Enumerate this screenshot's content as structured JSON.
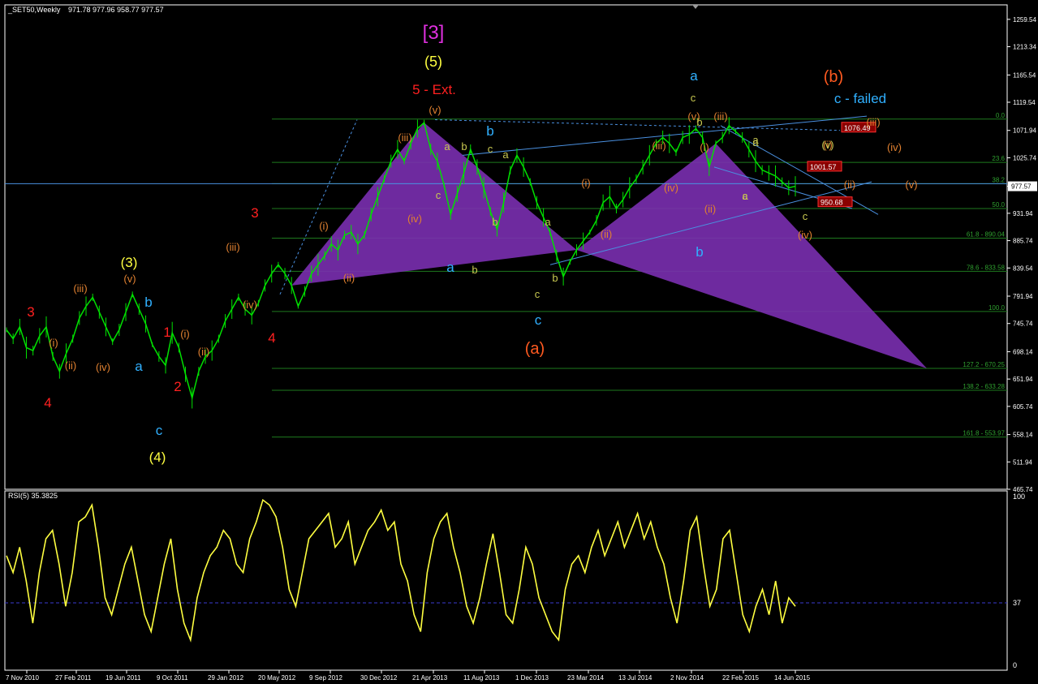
{
  "header": {
    "symbol": "_SET50,Weekly",
    "ohlc": "971.78 977.96 958.77 977.57"
  },
  "rsi_header": "RSI(5) 35.3825",
  "colors": {
    "background": "#000000",
    "frame": "#ffffff",
    "candles": "#00e000",
    "rsi": "#ffff40",
    "fib": "#1e7a1e",
    "pattern": "#7a2fb0",
    "trend": "#4a90e0"
  },
  "chart_data": [
    {
      "type": "line",
      "title": "",
      "xlabel": "",
      "ylabel": "",
      "x_ticks": [
        "7 Nov 2010",
        "27 Feb 2011",
        "19 Jun 2011",
        "9 Oct 2011",
        "29 Jan 2012",
        "20 May 2012",
        "9 Sep 2012",
        "30 Dec 2012",
        "21 Apr 2013",
        "11 Aug 2013",
        "1 Dec 2013",
        "23 Mar 2014",
        "13 Jul 2014",
        "2 Nov 2014",
        "22 Feb 2015",
        "14 Jun 2015"
      ],
      "y_ticks": [
        "1259.54",
        "1213.34",
        "1165.54",
        "1119.54",
        "1071.94",
        "1025.74",
        "977.57",
        "931.94",
        "885.74",
        "839.54",
        "791.94",
        "745.74",
        "698.14",
        "651.94",
        "605.74",
        "558.14",
        "511.94",
        "465.74"
      ],
      "ylim": [
        465.74,
        1284
      ],
      "last_price": "977.57",
      "series": [
        {
          "values": [
            735,
            720,
            740,
            705,
            700,
            725,
            740,
            690,
            665,
            695,
            720,
            755,
            775,
            790,
            765,
            740,
            715,
            735,
            765,
            795,
            770,
            745,
            710,
            690,
            675,
            730,
            705,
            660,
            620,
            665,
            690,
            700,
            720,
            750,
            770,
            790,
            770,
            760,
            780,
            810,
            830,
            845,
            830,
            810,
            775,
            800,
            830,
            845,
            860,
            880,
            870,
            895,
            900,
            880,
            895,
            930,
            960,
            990,
            1020,
            1040,
            1020,
            1050,
            1075,
            1085,
            1040,
            1020,
            980,
            930,
            965,
            1000,
            1040,
            1010,
            975,
            935,
            905,
            950,
            1005,
            1030,
            1010,
            985,
            950,
            925,
            900,
            860,
            825,
            850,
            870,
            885,
            900,
            920,
            950,
            960,
            940,
            955,
            975,
            990,
            1010,
            1030,
            1050,
            1060,
            1050,
            1035,
            1060,
            1065,
            1075,
            1060,
            1010,
            1050,
            1060,
            1080,
            1070,
            1060,
            1040,
            1020,
            1005,
            1000,
            995,
            985,
            975,
            977.57
          ]
        }
      ],
      "fib_levels": [
        {
          "label": "0.0",
          "price": 1091
        },
        {
          "label": "23.6",
          "price": 1018
        },
        {
          "label": "38.2",
          "price": 982
        },
        {
          "label": "50.0",
          "price": 940
        },
        {
          "label": "61.8 - 890.04",
          "price": 890
        },
        {
          "label": "78.6 - 833.58",
          "price": 834
        },
        {
          "label": "100.0",
          "price": 766
        },
        {
          "label": "127.2 - 670.25",
          "price": 670
        },
        {
          "label": "138.2 - 633.28",
          "price": 633
        },
        {
          "label": "161.8 - 553.97",
          "price": 554
        }
      ],
      "price_tags": [
        "1076.49",
        "1001.57",
        "950.68"
      ],
      "wave_labels": [
        {
          "t": "[3]",
          "c": "#e030e0",
          "s": 24
        },
        {
          "t": "(5)",
          "c": "#ffff40",
          "s": 18
        },
        {
          "t": "5 - Ext.",
          "c": "#ff2020",
          "s": 17
        },
        {
          "t": "a",
          "c": "#30b0ff",
          "s": 17
        },
        {
          "t": "(b)",
          "c": "#ff5a20",
          "s": 20
        },
        {
          "t": "c - failed",
          "c": "#30b0ff",
          "s": 17
        },
        {
          "t": "(3)",
          "c": "#ffff40",
          "s": 17
        },
        {
          "t": "(4)",
          "c": "#ffff40",
          "s": 17
        },
        {
          "t": "(a)",
          "c": "#ff5a20",
          "s": 20
        },
        {
          "t": "3",
          "c": "#ff2020",
          "s": 17
        },
        {
          "t": "4",
          "c": "#ff2020",
          "s": 17
        },
        {
          "t": "3",
          "c": "#ff2020",
          "s": 17
        },
        {
          "t": "4",
          "c": "#ff2020",
          "s": 17
        },
        {
          "t": "1",
          "c": "#ff2020",
          "s": 17
        },
        {
          "t": "2",
          "c": "#ff2020",
          "s": 17
        },
        {
          "t": "a",
          "c": "#30b0ff",
          "s": 17
        },
        {
          "t": "b",
          "c": "#30b0ff",
          "s": 17
        },
        {
          "t": "c",
          "c": "#30b0ff",
          "s": 17
        },
        {
          "t": "b",
          "c": "#30b0ff",
          "s": 17
        },
        {
          "t": "a",
          "c": "#30b0ff",
          "s": 17
        },
        {
          "t": "c",
          "c": "#30b0ff",
          "s": 17
        },
        {
          "t": "b",
          "c": "#30b0ff",
          "s": 17
        },
        {
          "t": "(i)",
          "c": "#e08030",
          "s": 13
        },
        {
          "t": "(ii)",
          "c": "#e08030",
          "s": 13
        },
        {
          "t": "(iii)",
          "c": "#e08030",
          "s": 13
        },
        {
          "t": "(iv)",
          "c": "#e08030",
          "s": 13
        },
        {
          "t": "(v)",
          "c": "#e08030",
          "s": 13
        },
        {
          "t": "(i)",
          "c": "#e08030",
          "s": 13
        },
        {
          "t": "(ii)",
          "c": "#e08030",
          "s": 13
        },
        {
          "t": "(iii)",
          "c": "#e08030",
          "s": 13
        },
        {
          "t": "(iv)",
          "c": "#e08030",
          "s": 13
        },
        {
          "t": "(i)",
          "c": "#e08030",
          "s": 13
        },
        {
          "t": "(ii)",
          "c": "#e08030",
          "s": 13
        },
        {
          "t": "(iii)",
          "c": "#e08030",
          "s": 13
        },
        {
          "t": "(iv)",
          "c": "#e08030",
          "s": 13
        },
        {
          "t": "(v)",
          "c": "#e08030",
          "s": 13
        },
        {
          "t": "(i)",
          "c": "#e08030",
          "s": 13
        },
        {
          "t": "(ii)",
          "c": "#e08030",
          "s": 13
        },
        {
          "t": "(iii)",
          "c": "#e08030",
          "s": 13
        },
        {
          "t": "(iv)",
          "c": "#e08030",
          "s": 13
        },
        {
          "t": "(v)",
          "c": "#e08030",
          "s": 13
        },
        {
          "t": "(i)",
          "c": "#e08030",
          "s": 13
        },
        {
          "t": "(ii)",
          "c": "#e08030",
          "s": 13
        },
        {
          "t": "(iii)",
          "c": "#e08030",
          "s": 13
        },
        {
          "t": "(iv)",
          "c": "#e08030",
          "s": 13
        },
        {
          "t": "(i)",
          "c": "#e08030",
          "s": 13
        },
        {
          "t": "(ii)",
          "c": "#e08030",
          "s": 13
        },
        {
          "t": "(iii)",
          "c": "#e08030",
          "s": 13
        },
        {
          "t": "(iv)",
          "c": "#e08030",
          "s": 13
        },
        {
          "t": "(v)",
          "c": "#e08030",
          "s": 13
        },
        {
          "t": "(v)",
          "c": "#c8c850",
          "s": 13
        },
        {
          "t": "a",
          "c": "#c8c850",
          "s": 13
        },
        {
          "t": "b",
          "c": "#c8c850",
          "s": 13
        },
        {
          "t": "c",
          "c": "#c8c850",
          "s": 13
        },
        {
          "t": "c",
          "c": "#c8c850",
          "s": 13
        },
        {
          "t": "b",
          "c": "#c8c850",
          "s": 13
        },
        {
          "t": "a",
          "c": "#c8c850",
          "s": 13
        },
        {
          "t": "b",
          "c": "#c8c850",
          "s": 13
        },
        {
          "t": "a",
          "c": "#c8c850",
          "s": 13
        },
        {
          "t": "c",
          "c": "#c8c850",
          "s": 13
        },
        {
          "t": "b",
          "c": "#c8c850",
          "s": 13
        },
        {
          "t": "a",
          "c": "#c8c850",
          "s": 13
        },
        {
          "t": "a",
          "c": "#c8c850",
          "s": 13
        },
        {
          "t": "c",
          "c": "#c8c850",
          "s": 13
        },
        {
          "t": "c",
          "c": "#c8c850",
          "s": 13
        },
        {
          "t": "b",
          "c": "#c8c850",
          "s": 13
        },
        {
          "t": "a",
          "c": "#c8c850",
          "s": 13
        },
        {
          "t": "c",
          "c": "#c8c850",
          "s": 13
        }
      ]
    },
    {
      "type": "line",
      "title": "RSI(5) 35.3825",
      "y_ticks": [
        "100",
        "37",
        "0"
      ],
      "ylim": [
        0,
        100
      ],
      "reference_level": 37,
      "series": [
        {
          "values": [
            65,
            55,
            70,
            50,
            25,
            55,
            75,
            80,
            60,
            35,
            55,
            85,
            88,
            95,
            70,
            40,
            30,
            45,
            60,
            70,
            50,
            30,
            20,
            40,
            60,
            75,
            45,
            25,
            15,
            40,
            55,
            65,
            70,
            80,
            75,
            60,
            55,
            75,
            85,
            98,
            95,
            88,
            70,
            45,
            35,
            55,
            75,
            80,
            85,
            90,
            70,
            75,
            85,
            60,
            70,
            80,
            85,
            92,
            80,
            85,
            60,
            50,
            30,
            20,
            55,
            75,
            85,
            90,
            70,
            55,
            35,
            25,
            40,
            60,
            78,
            55,
            30,
            25,
            45,
            70,
            60,
            40,
            30,
            20,
            15,
            45,
            60,
            65,
            55,
            70,
            80,
            65,
            75,
            85,
            70,
            80,
            90,
            75,
            85,
            70,
            60,
            40,
            25,
            50,
            80,
            88,
            60,
            35,
            45,
            75,
            80,
            55,
            30,
            20,
            35,
            45,
            30,
            50,
            25,
            40,
            35
          ]
        }
      ]
    }
  ]
}
